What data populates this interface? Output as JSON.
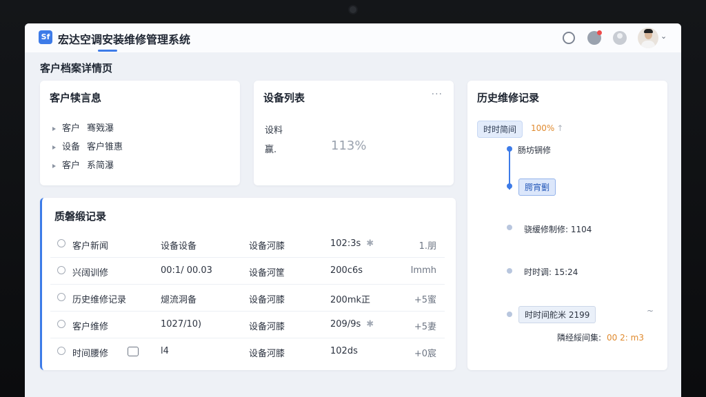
{
  "app": {
    "title": "宏达空调安装维修管理系统",
    "logo_text": "Sf"
  },
  "page_title": "客户档案详情页",
  "customer_info": {
    "title": "客户犊言息",
    "items": [
      {
        "label": "客户",
        "value": "骞戣瀑"
      },
      {
        "label": "设备",
        "value": "客户锥惠"
      },
      {
        "label": "客户",
        "value": "系简瀑"
      }
    ]
  },
  "devices": {
    "title": "设备列表",
    "more_icon": "more-icon",
    "line1": "设料",
    "line2": "赢.",
    "percent": "113%"
  },
  "history": {
    "title": "历史维修记录",
    "badge": "时时简间",
    "badge_pct": "100%",
    "badge_arrow": "↑",
    "step1": "肠坊锎修",
    "step2": "腭宵劐",
    "step3": "骁缓修制修: 1104",
    "step4": "时时调: 15:24",
    "step5": "时时间舵米 2199",
    "wave": "~",
    "foot_label": "隣经綏间集:",
    "foot_value": "00 2: m3"
  },
  "records": {
    "title": "质磐缎记录",
    "rows": [
      {
        "a": "客户新闻",
        "b": "设备设备",
        "c": "设备河膝",
        "d": "102:3s",
        "d_icon": "✱",
        "e": "1.朋"
      },
      {
        "a": "兴阔训修",
        "b": "00:1/ 00.03",
        "c": "设备河筐",
        "d": "200c6s",
        "d_icon": "",
        "e": "Immh"
      },
      {
        "a": "历史维修记录",
        "b": "煺流洞备",
        "c": "设备河膝",
        "d": "200mk正",
        "d_icon": "",
        "e": "+5蜜"
      },
      {
        "a": "客户维修",
        "b": "1027/10)",
        "c": "设备河膝",
        "d": "209/9s",
        "d_icon": "✱",
        "e": "+5妻"
      },
      {
        "a": "时间腰修",
        "b": "l4",
        "c": "设备河膝",
        "d": "102ds",
        "d_icon": "",
        "e": "+0宸"
      }
    ]
  },
  "colors": {
    "accent": "#3d7be8",
    "orange": "#e08a2e"
  }
}
